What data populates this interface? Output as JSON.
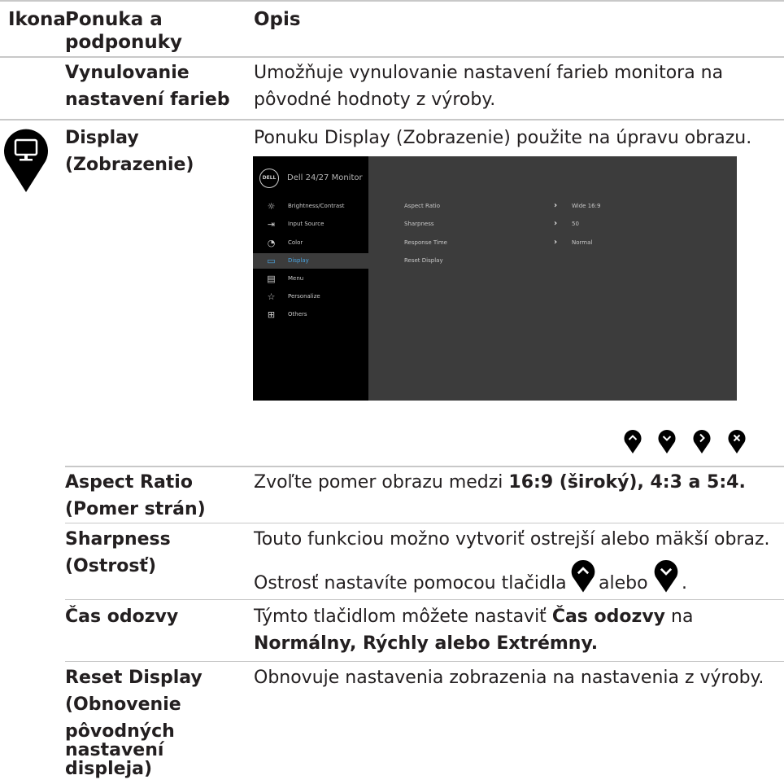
{
  "header": {
    "col_icon": "Ikona",
    "col_menu_line1": "Ponuka a",
    "col_menu_line2": "podponuky",
    "col_desc": "Opis"
  },
  "rows": {
    "reset_color": {
      "name_line1": "Vynulovanie",
      "name_line2": "nastavení farieb",
      "desc_line1": "Umožňuje vynulovanie nastavení farieb monitora na",
      "desc_line2": "pôvodné hodnoty z výroby."
    },
    "display": {
      "name_line1": "Display",
      "name_line2": "(Zobrazenie)",
      "desc": "Ponuku Display (Zobrazenie) použite na úpravu obrazu."
    },
    "aspect_ratio": {
      "name_line1": "Aspect Ratio",
      "name_line2": "(Pomer strán)",
      "desc_normal": "Zvoľte pomer obrazu medzi ",
      "desc_bold": "16:9 (široký), 4:3 a 5:4."
    },
    "sharpness": {
      "name_line1": "Sharpness",
      "name_line2": "(Ostrosť)",
      "desc_line1": "Touto funkciou možno vytvoriť ostrejší alebo mäkší obraz.",
      "desc_line2_a": "Ostrosť nastavíte pomocou tlačidla",
      "desc_line2_b": "alebo",
      "desc_line2_c": "."
    },
    "response_time": {
      "name": "Čas odozvy",
      "desc_a": "Týmto tlačidlom môžete nastaviť ",
      "desc_b": "Čas odozvy",
      "desc_c": " na",
      "desc_line2": "Normálny, Rýchly alebo Extrémny."
    },
    "reset_display": {
      "name_line1": "Reset Display",
      "name_line2": "(Obnovenie",
      "name_line3": "pôvodných",
      "name_line4": "nastavení",
      "name_line5": "displeja)",
      "desc": "Obnovuje nastavenia zobrazenia na nastavenia z výroby."
    }
  },
  "osd": {
    "logo": "DELL",
    "title": "Dell 24/27 Monitor",
    "menu": [
      {
        "label": "Brightness/Contrast",
        "icon": "sun-icon"
      },
      {
        "label": "Input Source",
        "icon": "input-icon"
      },
      {
        "label": "Color",
        "icon": "palette-icon"
      },
      {
        "label": "Display",
        "icon": "monitor-icon",
        "active": true
      },
      {
        "label": "Menu",
        "icon": "menu-icon"
      },
      {
        "label": "Personalize",
        "icon": "star-icon"
      },
      {
        "label": "Others",
        "icon": "others-icon"
      }
    ],
    "settings": [
      {
        "label": "Aspect Ratio",
        "value": "Wide 16:9"
      },
      {
        "label": "Sharpness",
        "value": "50"
      },
      {
        "label": "Response Time",
        "value": "Normal"
      },
      {
        "label": "Reset Display",
        "value": ""
      }
    ]
  },
  "nav_buttons": [
    "up-button-icon",
    "down-button-icon",
    "right-button-icon",
    "close-button-icon"
  ],
  "colors": {
    "rule": "#c8c8c8",
    "text": "#231f20",
    "osd_bg": "#3c3c3c",
    "osd_left": "#000000",
    "osd_active": "#4aa3df"
  }
}
